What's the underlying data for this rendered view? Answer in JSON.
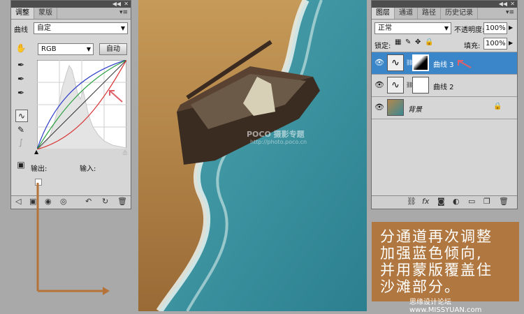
{
  "curves_panel": {
    "tabs": [
      "调整",
      "蒙版"
    ],
    "preset_label": "曲线",
    "preset_value": "自定",
    "channel_value": "RGB",
    "auto_button": "自动",
    "output_label": "输出:",
    "input_label": "输入:"
  },
  "layers_panel": {
    "tabs": [
      "图层",
      "通道",
      "路径",
      "历史记录"
    ],
    "blend_mode": "正常",
    "opacity_label": "不透明度:",
    "opacity_value": "100%",
    "lock_label": "锁定:",
    "fill_label": "填充:",
    "fill_value": "100%",
    "layers": [
      {
        "name": "曲线 3",
        "selected": true,
        "type": "curves-with-mask"
      },
      {
        "name": "曲线 2",
        "selected": false,
        "type": "curves-with-mask"
      },
      {
        "name": "背景",
        "selected": false,
        "type": "background"
      }
    ]
  },
  "photo": {
    "watermark": "POCO 摄影专题",
    "watermark_url": "http://photo.poco.cn"
  },
  "annotation": {
    "lines": [
      "分通道再次调整",
      "加强蓝色倾向,",
      "并用蒙版覆盖住",
      "沙滩部分。"
    ]
  },
  "site_watermark": "思缘设计论坛 www.MISSYUAN.com",
  "colors": {
    "annotation_bg": "#b07840",
    "arrow": "#b5733a",
    "selected_layer": "#3a86c8",
    "red_arrow": "#e0606a"
  }
}
